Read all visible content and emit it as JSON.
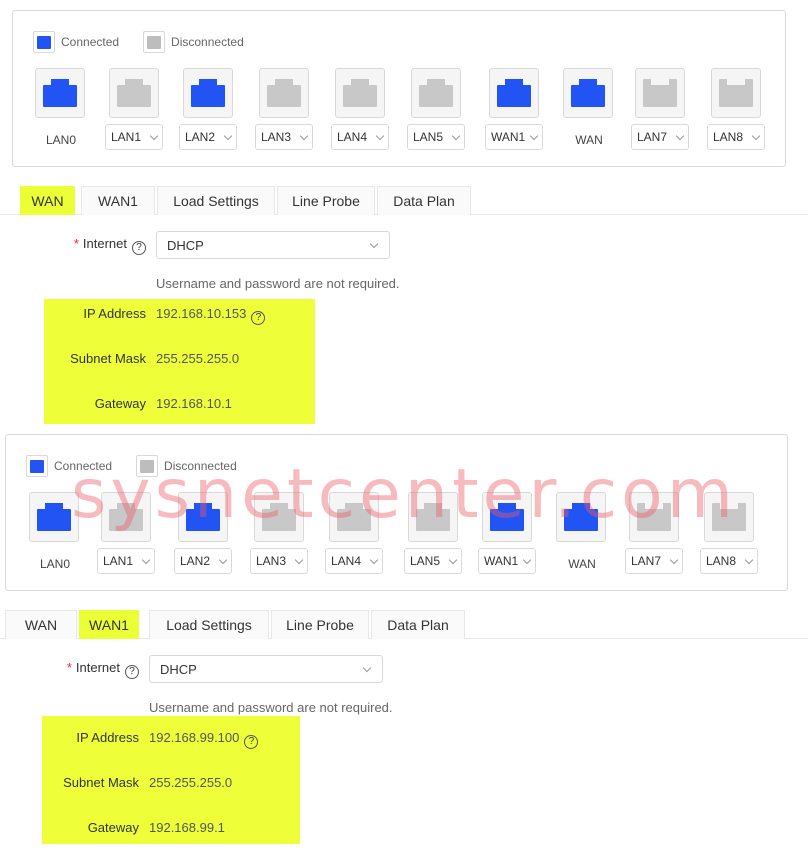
{
  "legend": {
    "connected": "Connected",
    "disconnected": "Disconnected"
  },
  "colors": {
    "connected": "#2254f4",
    "disconnected": "#c8c8c8",
    "highlight": "#eeff3a"
  },
  "panel1": {
    "ports": [
      {
        "label": "LAN0",
        "dropdown": false,
        "connected": true
      },
      {
        "label": "LAN1",
        "dropdown": true,
        "connected": false
      },
      {
        "label": "LAN2",
        "dropdown": true,
        "connected": true
      },
      {
        "label": "LAN3",
        "dropdown": true,
        "connected": false
      },
      {
        "label": "LAN4",
        "dropdown": true,
        "connected": false
      },
      {
        "label": "LAN5",
        "dropdown": true,
        "connected": false
      },
      {
        "label": "WAN1",
        "dropdown": true,
        "connected": true
      },
      {
        "label": "WAN",
        "dropdown": false,
        "connected": true
      },
      {
        "label": "LAN7",
        "dropdown": true,
        "connected": false
      },
      {
        "label": "LAN8",
        "dropdown": true,
        "connected": false
      }
    ],
    "tabs": [
      "WAN",
      "WAN1",
      "Load Settings",
      "Line Probe",
      "Data Plan"
    ],
    "active_tab": "WAN",
    "form": {
      "internet_label": "Internet",
      "internet_value": "DHCP",
      "hint": "Username and password are not required.",
      "ip_label": "IP Address",
      "ip_value": "192.168.10.153",
      "mask_label": "Subnet Mask",
      "mask_value": "255.255.255.0",
      "gateway_label": "Gateway",
      "gateway_value": "192.168.10.1"
    }
  },
  "panel2": {
    "ports": [
      {
        "label": "LAN0",
        "dropdown": false,
        "connected": true
      },
      {
        "label": "LAN1",
        "dropdown": true,
        "connected": false
      },
      {
        "label": "LAN2",
        "dropdown": true,
        "connected": true
      },
      {
        "label": "LAN3",
        "dropdown": true,
        "connected": false
      },
      {
        "label": "LAN4",
        "dropdown": true,
        "connected": false
      },
      {
        "label": "LAN5",
        "dropdown": true,
        "connected": false
      },
      {
        "label": "WAN1",
        "dropdown": true,
        "connected": true
      },
      {
        "label": "WAN",
        "dropdown": false,
        "connected": true
      },
      {
        "label": "LAN7",
        "dropdown": true,
        "connected": false
      },
      {
        "label": "LAN8",
        "dropdown": true,
        "connected": false
      }
    ],
    "tabs": [
      "WAN",
      "WAN1",
      "Load Settings",
      "Line Probe",
      "Data Plan"
    ],
    "active_tab": "WAN1",
    "form": {
      "internet_label": "Internet",
      "internet_value": "DHCP",
      "hint": "Username and password are not required.",
      "ip_label": "IP Address",
      "ip_value": "192.168.99.100",
      "mask_label": "Subnet Mask",
      "mask_value": "255.255.255.0",
      "gateway_label": "Gateway",
      "gateway_value": "192.168.99.1"
    }
  },
  "watermark": "sysnetcenter.com"
}
